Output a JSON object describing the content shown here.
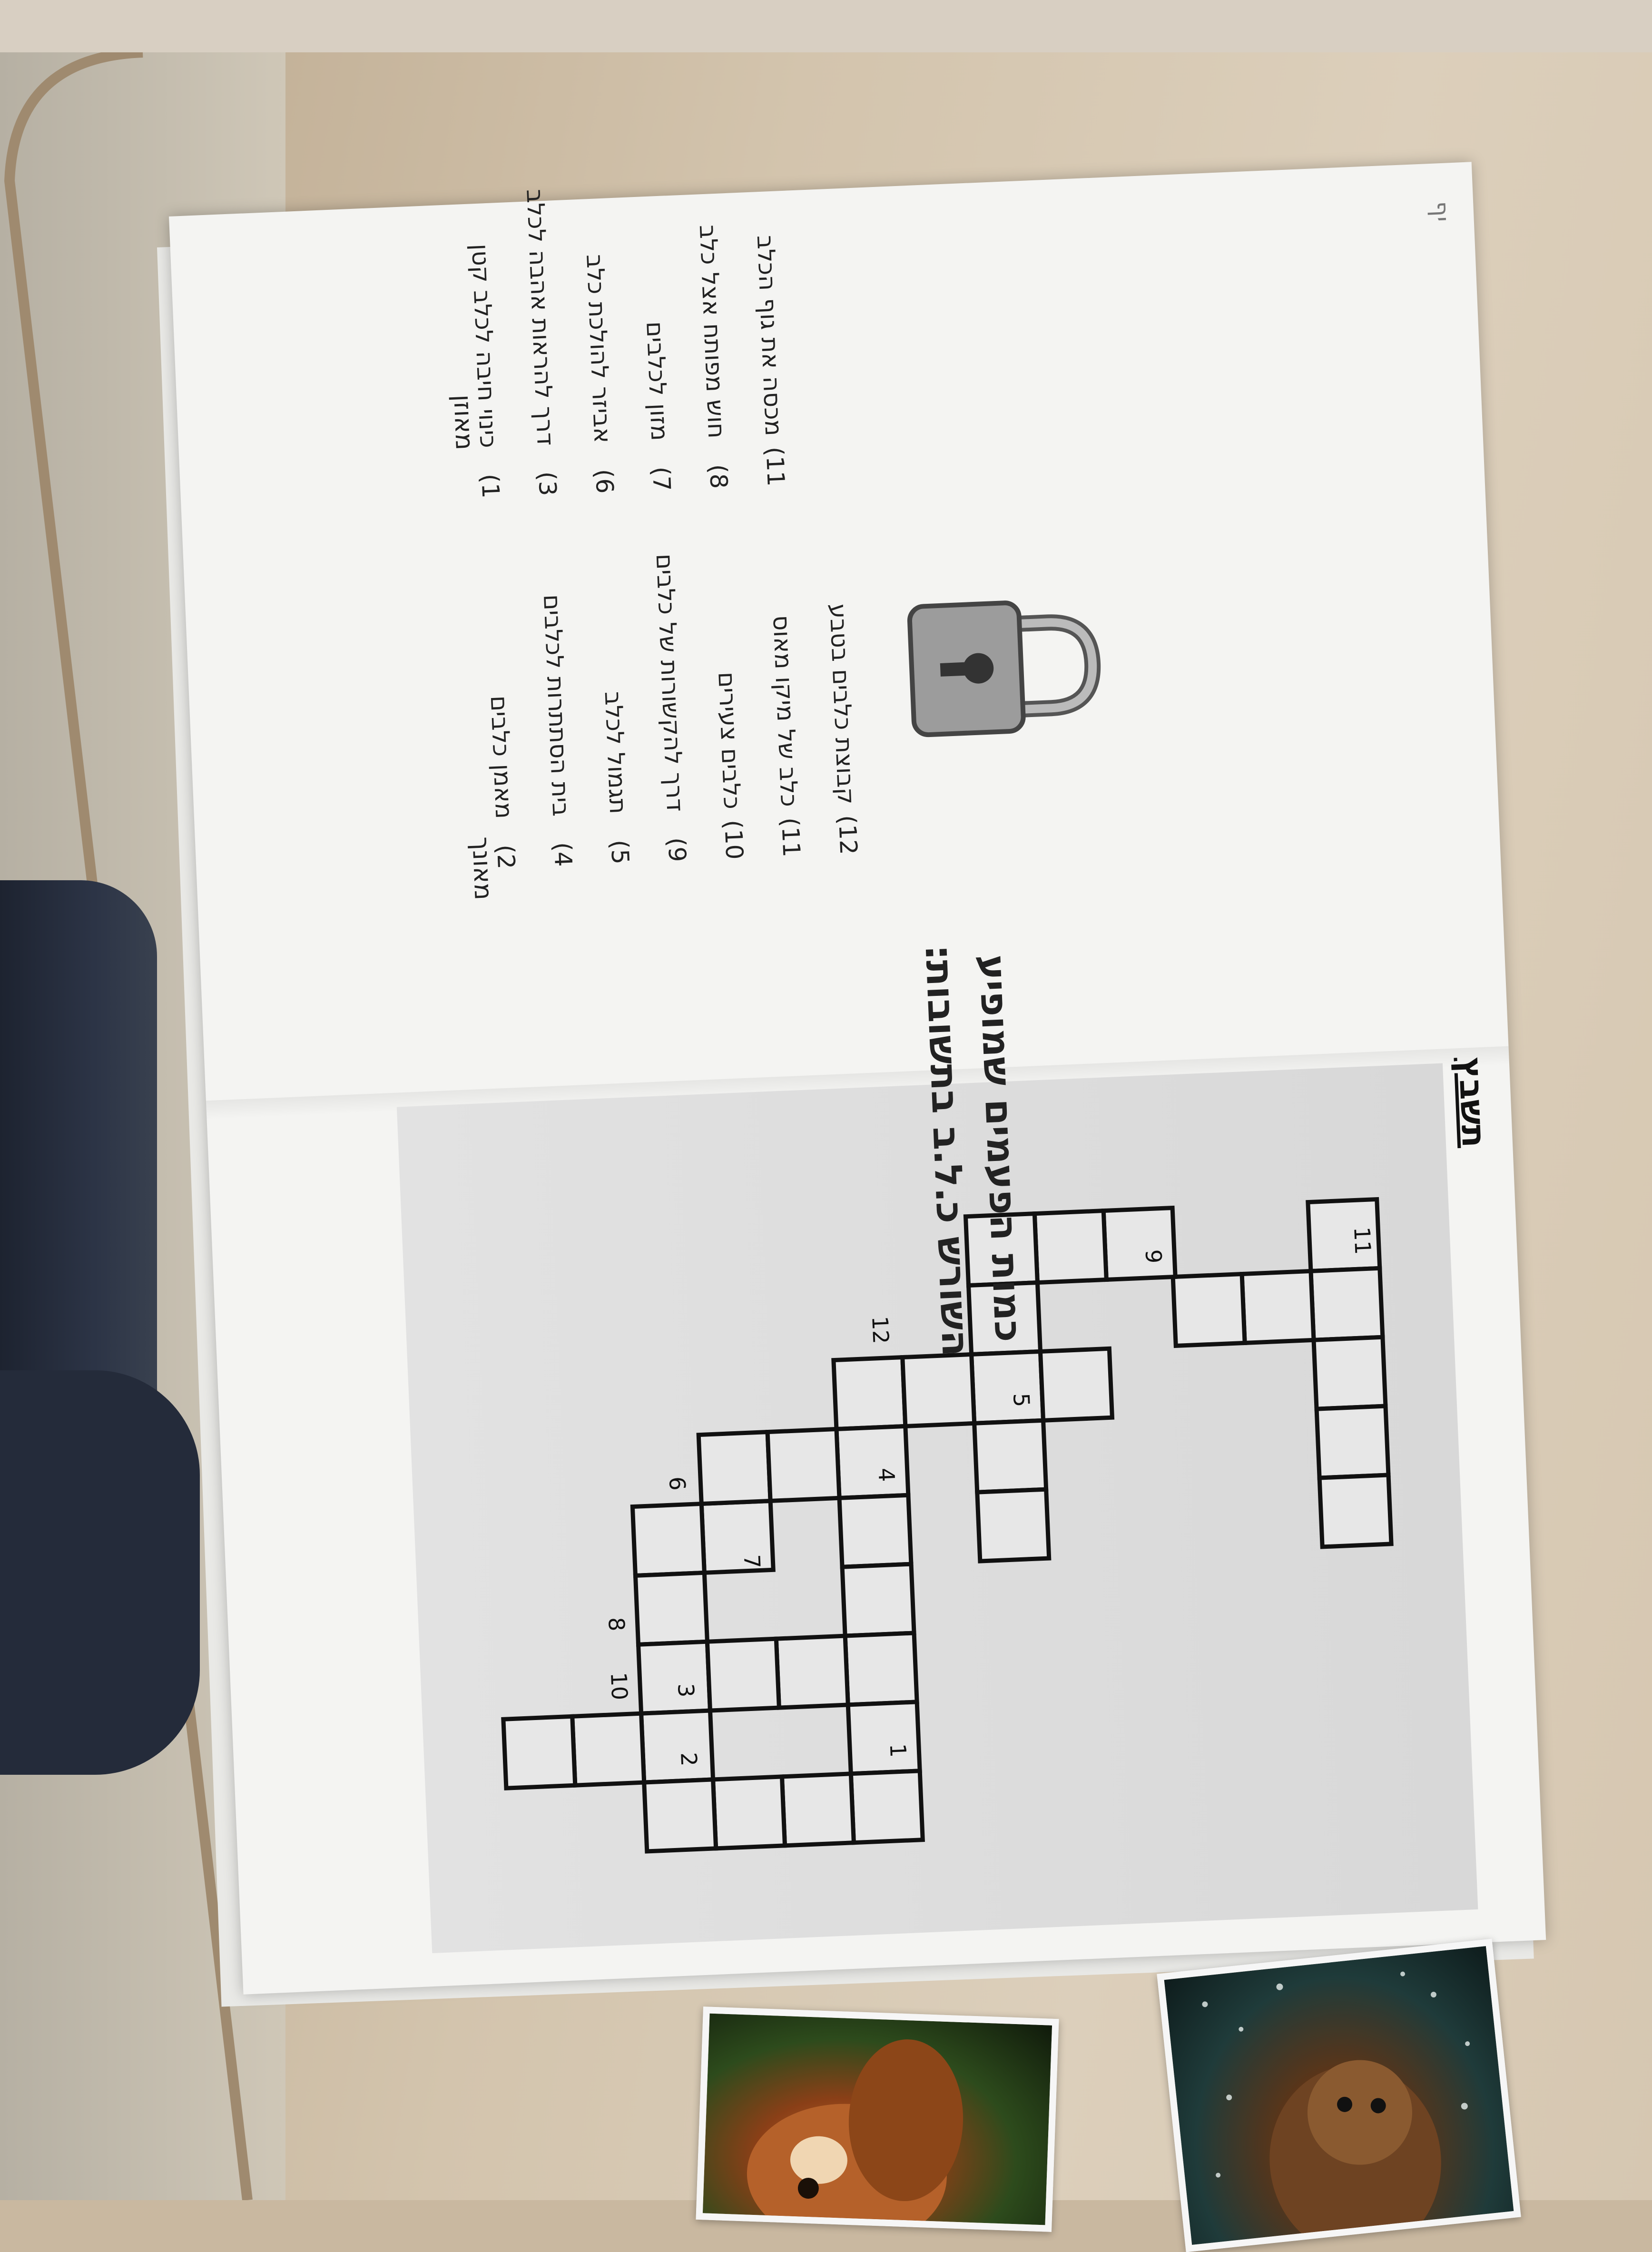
{
  "worksheet": {
    "page_number": "יף",
    "answer_title": "תשבץ",
    "across_title": "מאוזן",
    "down_title": "מאונך",
    "across_clues": [
      {
        "n": "1)",
        "text": "כינוי חיבה לכלב קטן"
      },
      {
        "n": "3)",
        "text": "דרך להראות אהבה לכלב"
      },
      {
        "n": "6)",
        "text": "אביזר להולכת כלב"
      },
      {
        "n": "7)",
        "text": "מזון לכלבים"
      },
      {
        "n": "8)",
        "text": "חוש מפותח אצל כלב"
      },
      {
        "n": "11)",
        "text": "מכסה את גוף הכלב"
      }
    ],
    "down_clues": [
      {
        "n": "2)",
        "text": "מאמן כלבים"
      },
      {
        "n": "4)",
        "text": "בית הסתתרות לכלבים"
      },
      {
        "n": "5)",
        "text": "תגמול לכלב"
      },
      {
        "n": "9)",
        "text": "דרך להקשורות של כלבים"
      },
      {
        "n": "10)",
        "text": "כלבים צעירים"
      },
      {
        "n": "11)",
        "text": "כלב של מיקו מאוס"
      },
      {
        "n": "12)",
        "text": "קבוצת כלבים בטבע"
      }
    ],
    "bottom_line1": "כמות הפעמים שמופיע",
    "bottom_line2": "השורש כ.ל.ב בתשובות:",
    "lock_icon": "padlock-icon"
  },
  "grid_numbers": [
    "1",
    "2",
    "3",
    "4",
    "5",
    "6",
    "7",
    "8",
    "9",
    "10",
    "11",
    "12"
  ],
  "colors": {
    "table": "#d3c4ad",
    "paper": "#f4f4f2",
    "grid_panel": "#dcdcdc",
    "cell_border": "#111111"
  }
}
